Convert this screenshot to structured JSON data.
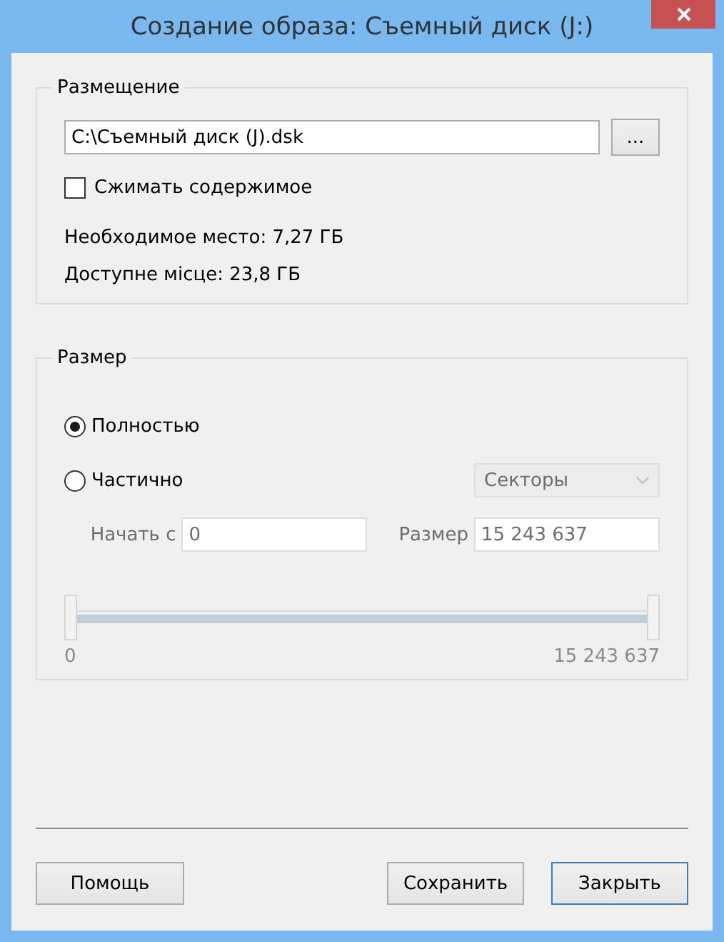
{
  "window": {
    "title": "Создание образа: Съемный диск (J:)"
  },
  "placement": {
    "title": "Размещение",
    "path": "C:\\Съемный диск (J).dsk",
    "browse": "...",
    "compress": {
      "label": "Сжимать содержимое",
      "checked": false
    },
    "required": "Необходимое место: 7,27 ГБ",
    "available": "Доступне місце: 23,8 ГБ"
  },
  "size": {
    "title": "Размер",
    "options": [
      {
        "label": "Полностью",
        "selected": true
      },
      {
        "label": "Частично",
        "selected": false
      }
    ],
    "unit": {
      "value": "Секторы",
      "disabled": true
    },
    "start": {
      "label": "Начать с",
      "value": "0",
      "disabled": true
    },
    "length": {
      "label": "Размер",
      "value": "15 243 637",
      "disabled": true
    },
    "range": {
      "level": 1,
      "min_label": "0",
      "max_label": "15 243 637",
      "disabled": true
    }
  },
  "buttons": [
    {
      "label": "Помощь",
      "kind": "help"
    },
    {
      "label": "Сохранить",
      "kind": "plain"
    },
    {
      "label": "Закрыть",
      "kind": "default"
    }
  ]
}
